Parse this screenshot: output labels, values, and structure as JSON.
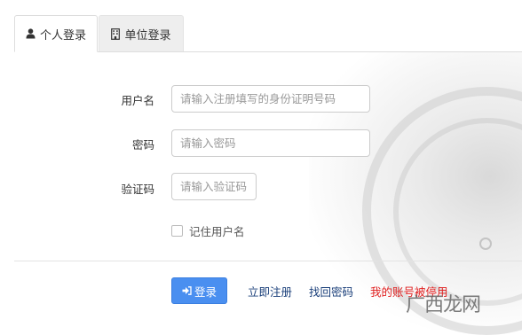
{
  "tabs": {
    "personal": "个人登录",
    "unit": "单位登录"
  },
  "form": {
    "username_label": "用户名",
    "username_placeholder": "请输入注册填写的身份证明号码",
    "password_label": "密码",
    "password_placeholder": "请输入密码",
    "captcha_label": "验证码",
    "captcha_placeholder": "请输入验证码",
    "remember_label": "记住用户名"
  },
  "actions": {
    "login": "登录",
    "register": "立即注册",
    "recover": "找回密码",
    "disabled_account": "我的账号被停用"
  },
  "watermark": "广西龙网",
  "colors": {
    "primary_button": "#4a8ff0",
    "link": "#1a3f7a",
    "alert_link": "#e02020"
  }
}
